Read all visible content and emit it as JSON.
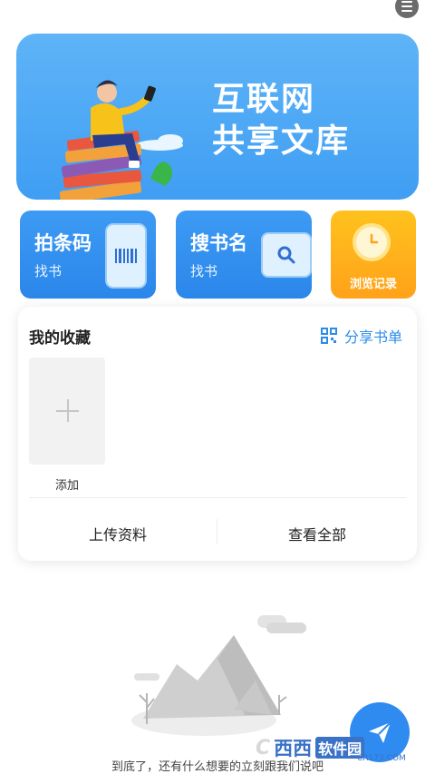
{
  "banner": {
    "title_line1": "互联网",
    "title_line2": "共享文库"
  },
  "cards": {
    "scan_barcode": {
      "title": "拍条码",
      "subtitle": "找书"
    },
    "search_title": {
      "title": "搜书名",
      "subtitle": "找书"
    },
    "history": {
      "label": "浏览记录"
    }
  },
  "favorites": {
    "title": "我的收藏",
    "share_label": "分享书单",
    "add_label": "添加",
    "upload_label": "上传资料",
    "view_all_label": "查看全部"
  },
  "footer": {
    "end_text": "到底了，还有什么想要的立刻跟我们说吧"
  },
  "watermark": {
    "logo": "C",
    "name": "西西",
    "brand": "软件园",
    "sub": "CR173.COM"
  },
  "colors": {
    "primary": "#2b86ea",
    "accent_orange": "#ffa21a",
    "link": "#2b8ce8"
  }
}
